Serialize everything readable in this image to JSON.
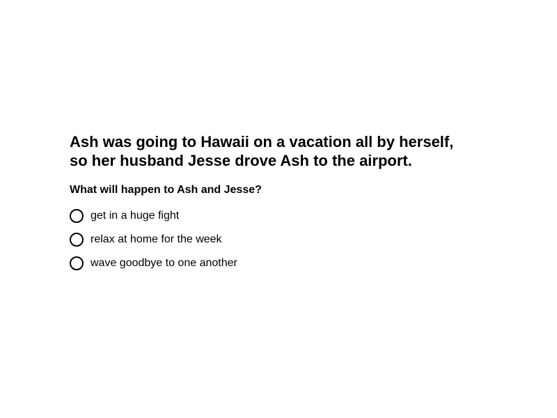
{
  "passage": "Ash was going to Hawaii on a vacation all by herself, so her husband Jesse drove Ash to the airport.",
  "question": "What will happen to Ash and Jesse?",
  "options": [
    {
      "label": "get in a huge fight",
      "selected": false
    },
    {
      "label": "relax at home for the week",
      "selected": false
    },
    {
      "label": "wave goodbye to one another",
      "selected": false
    }
  ],
  "colors": {
    "text": "#000000",
    "background": "#ffffff",
    "radio_border": "#000000"
  }
}
